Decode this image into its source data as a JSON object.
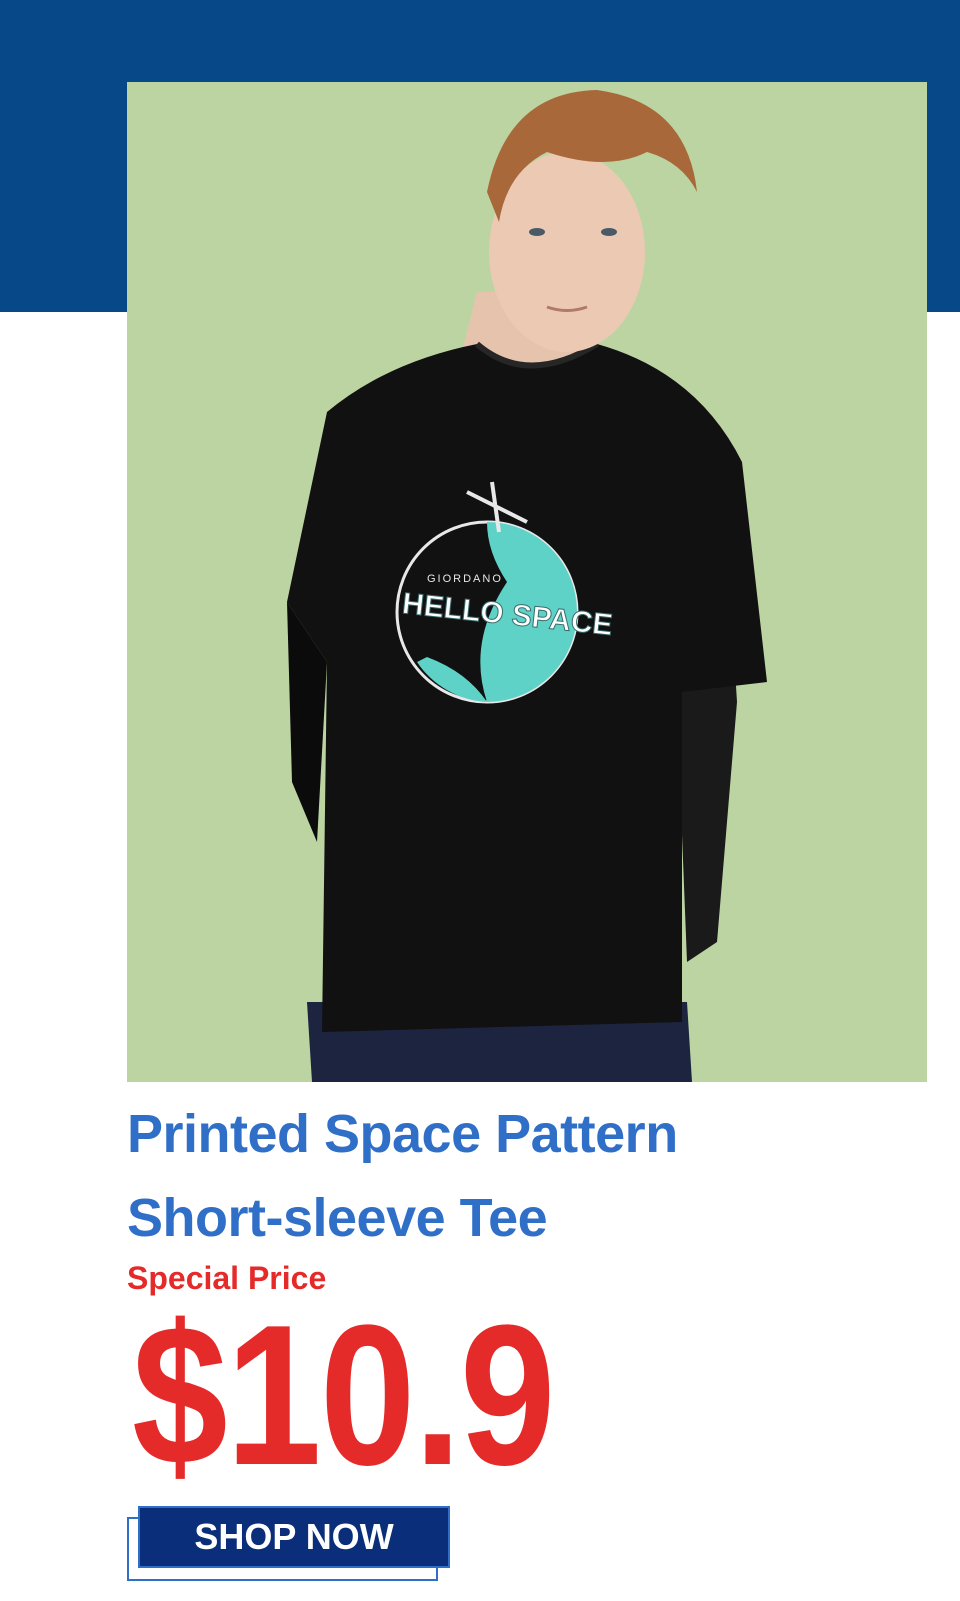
{
  "colors": {
    "band": "#074888",
    "photo_background": "#bcd4a2",
    "title": "#2f6fc7",
    "price": "#e52a2a",
    "button": "#0a2e7a",
    "button_text": "#ffffff"
  },
  "product": {
    "title_line1": "Printed Space Pattern",
    "title_line2": "Short-sleeve Tee",
    "price_label": "Special Price",
    "price": "$10.9",
    "image_icon": "model-tshirt-photo"
  },
  "tshirt_print": {
    "brand": "GIORDANO",
    "text": "HELLO SPACE"
  },
  "cta": {
    "label": "SHOP NOW"
  }
}
